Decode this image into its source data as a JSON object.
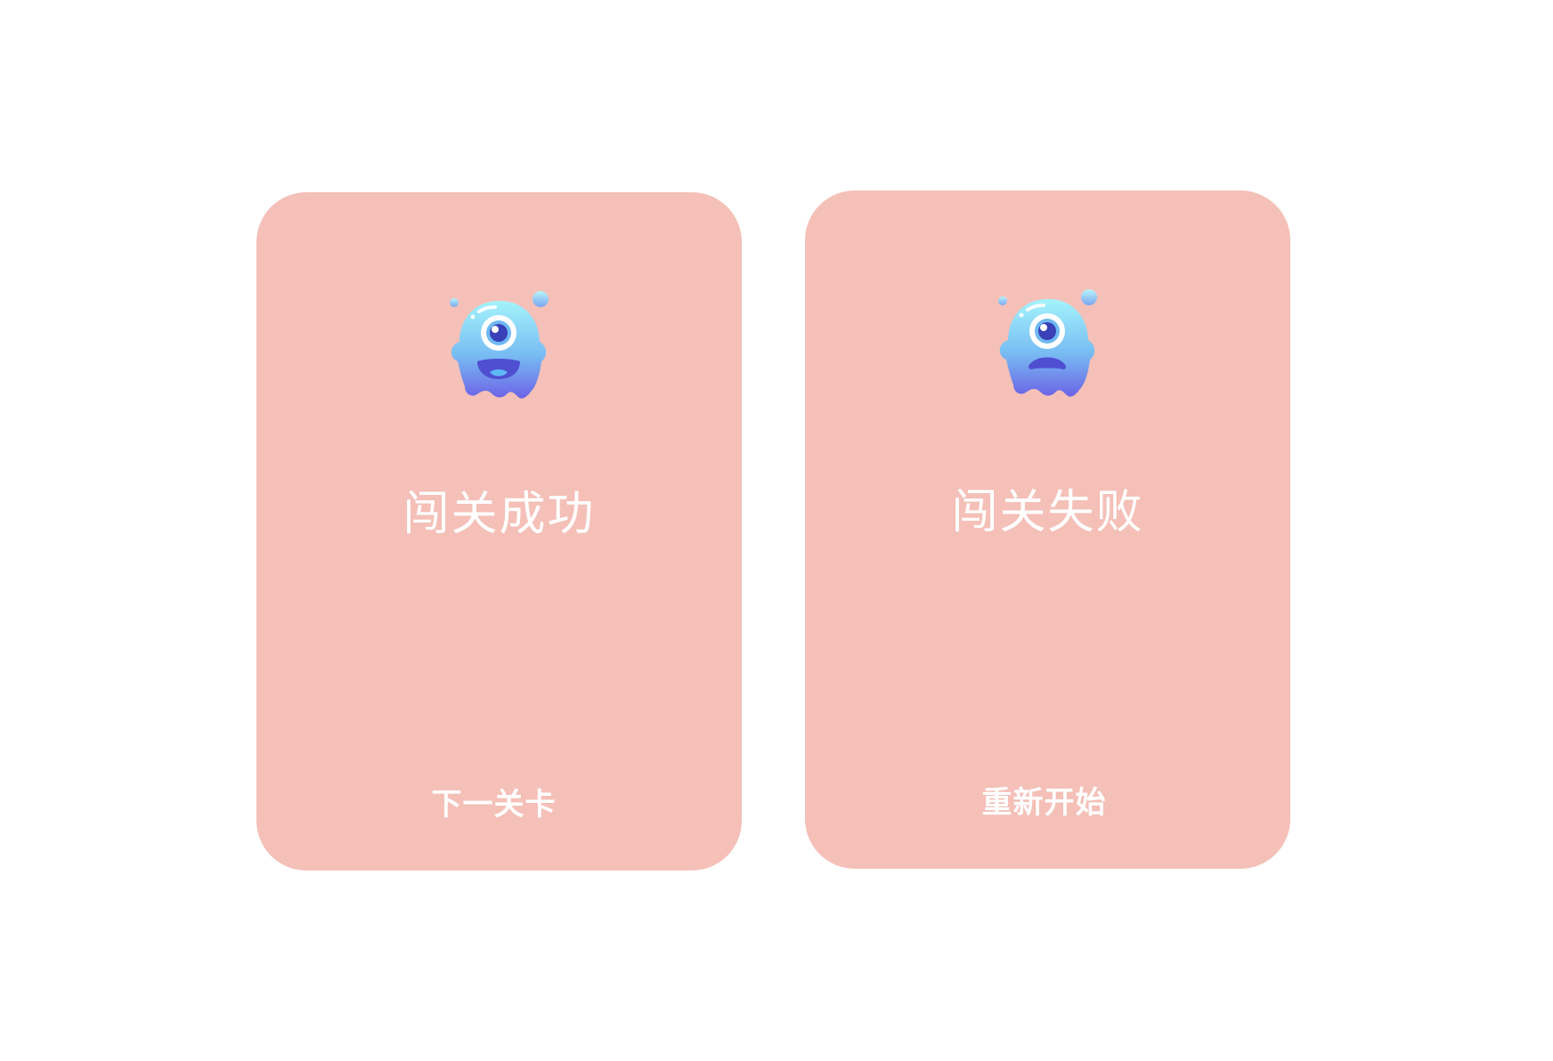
{
  "colors": {
    "background": "#ffffff",
    "card": "#f4c0b8",
    "text": "#ffffff",
    "mascot_top": "#9ef0fb",
    "mascot_bottom": "#6f6ee6"
  },
  "cards": [
    {
      "id": "success",
      "icon": "happy-monster-icon",
      "title": "闯关成功",
      "action_label": "下一关卡"
    },
    {
      "id": "fail",
      "icon": "sad-monster-icon",
      "title": "闯关失败",
      "action_label": "重新开始"
    }
  ]
}
